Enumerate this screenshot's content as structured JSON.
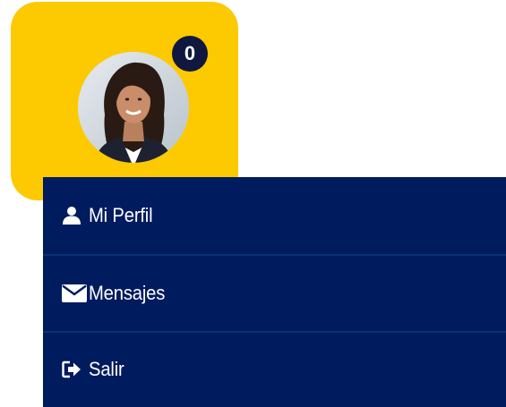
{
  "profile": {
    "notification_count": "0",
    "avatar_alt": "user avatar",
    "card_color": "#fdc900",
    "badge_color": "#10183f"
  },
  "menu": {
    "background": "#001b5e",
    "items": [
      {
        "label": "Mi Perfil",
        "icon": "user-icon"
      },
      {
        "label": "Mensajes",
        "icon": "envelope-icon"
      },
      {
        "label": "Salir",
        "icon": "sign-out-icon"
      }
    ]
  }
}
